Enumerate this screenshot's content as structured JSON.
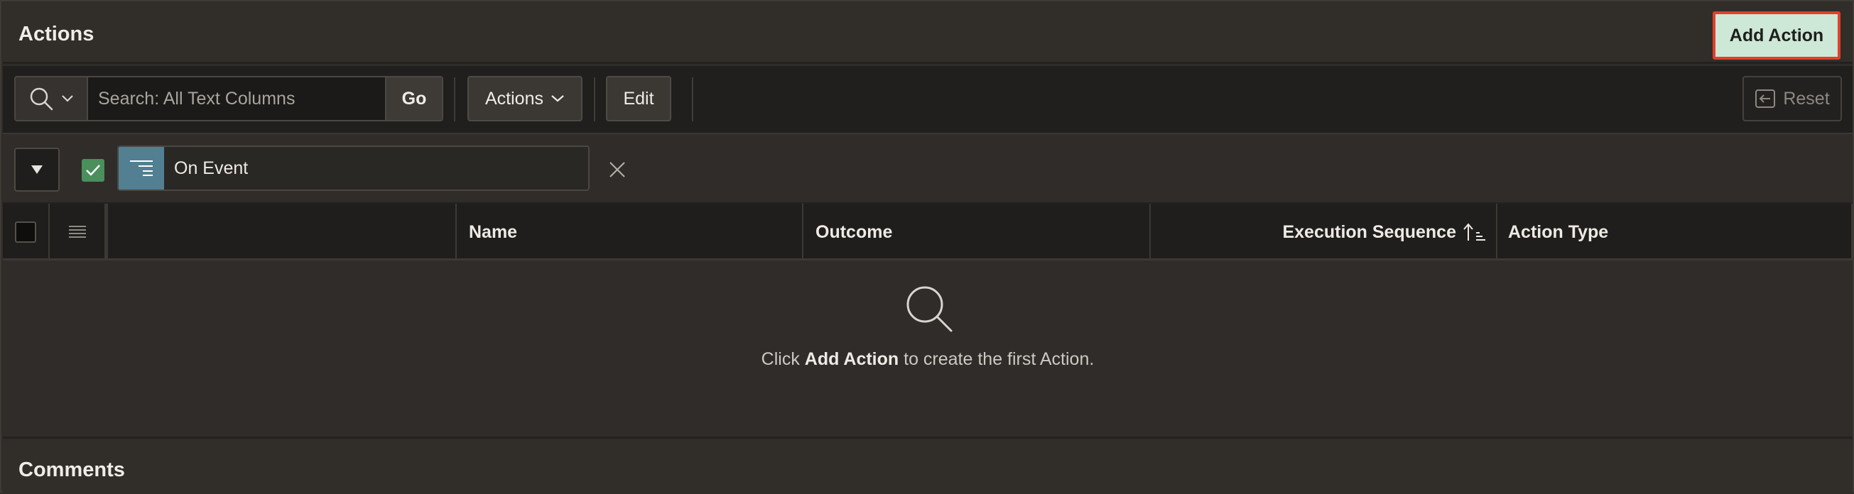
{
  "actions_region": {
    "title": "Actions",
    "add_button_label": "Add Action",
    "accent_color": "#cde8d6",
    "highlight_color": "#e0402a"
  },
  "toolbar": {
    "search_menu_icon": "search-icon",
    "search_placeholder": "Search: All Text Columns",
    "search_value": "",
    "go_label": "Go",
    "actions_menu_label": "Actions",
    "edit_label": "Edit",
    "reset_label": "Reset"
  },
  "filter": {
    "checked": true,
    "label": "On Event"
  },
  "table": {
    "columns": [
      {
        "label": "",
        "key": "select"
      },
      {
        "label": "",
        "key": "row-actions"
      },
      {
        "label": "",
        "key": "link"
      },
      {
        "label": "Name",
        "key": "name"
      },
      {
        "label": "Outcome",
        "key": "outcome"
      },
      {
        "label": "Execution Sequence",
        "key": "execution_sequence",
        "sorted": "ascending"
      },
      {
        "label": "Action Type",
        "key": "action_type"
      }
    ],
    "rows": []
  },
  "empty_state": {
    "prefix": "Click ",
    "emphasis": "Add Action",
    "suffix": " to create the first Action."
  },
  "comments_region": {
    "title": "Comments"
  }
}
